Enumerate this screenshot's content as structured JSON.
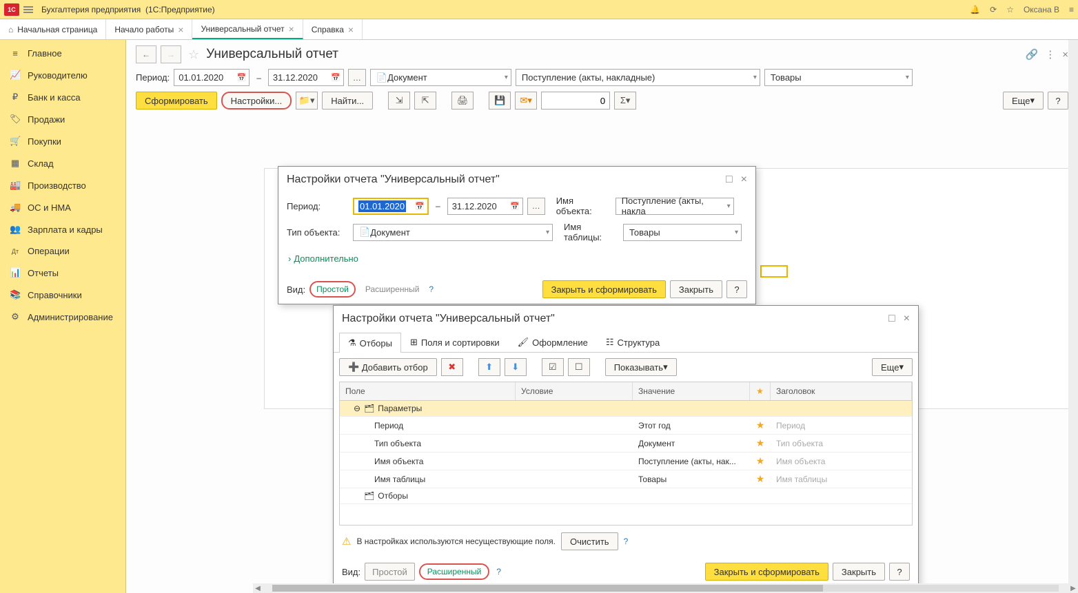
{
  "titlebar": {
    "app": "Бухгалтерия предприятия",
    "platform": "(1С:Предприятие)",
    "user": "Оксана В"
  },
  "main_tabs": [
    {
      "label": "Начальная страница",
      "closable": false,
      "home": true
    },
    {
      "label": "Начало работы",
      "closable": true
    },
    {
      "label": "Универсальный отчет",
      "closable": true,
      "active": true
    },
    {
      "label": "Справка",
      "closable": true
    }
  ],
  "sidebar": [
    {
      "icon": "≡",
      "label": "Главное"
    },
    {
      "icon": "📈",
      "label": "Руководителю"
    },
    {
      "icon": "₽",
      "label": "Банк и касса"
    },
    {
      "icon": "🏷",
      "label": "Продажи"
    },
    {
      "icon": "🛒",
      "label": "Покупки"
    },
    {
      "icon": "▦",
      "label": "Склад"
    },
    {
      "icon": "🏭",
      "label": "Производство"
    },
    {
      "icon": "🚚",
      "label": "ОС и НМА"
    },
    {
      "icon": "👥",
      "label": "Зарплата и кадры"
    },
    {
      "icon": "Дт",
      "label": "Операции"
    },
    {
      "icon": "📊",
      "label": "Отчеты"
    },
    {
      "icon": "📚",
      "label": "Справочники"
    },
    {
      "icon": "⚙",
      "label": "Администрирование"
    }
  ],
  "page": {
    "title": "Универсальный отчет"
  },
  "filters": {
    "period_label": "Период:",
    "date_from": "01.01.2020",
    "date_to": "31.12.2020",
    "dash": "–",
    "object_type": "Документ",
    "object_name": "Поступление (акты, накладные)",
    "table_name": "Товары"
  },
  "toolbar": {
    "form": "Сформировать",
    "settings": "Настройки...",
    "find": "Найти...",
    "num": "0",
    "more": "Еще",
    "help": "?"
  },
  "dialog1": {
    "title": "Настройки отчета \"Универсальный отчет\"",
    "period_label": "Период:",
    "date_from": "01.01.2020",
    "date_to": "31.12.2020",
    "objtype_label": "Тип объекта:",
    "objtype": "Документ",
    "objname_label": "Имя объекта:",
    "objname": "Поступление (акты, накла",
    "tblname_label": "Имя таблицы:",
    "tblname": "Товары",
    "more": "Дополнительно",
    "view_label": "Вид:",
    "view_simple": "Простой",
    "view_ext": "Расширенный",
    "close_form": "Закрыть и сформировать",
    "close": "Закрыть",
    "help": "?"
  },
  "dialog2": {
    "title": "Настройки отчета \"Универсальный отчет\"",
    "tabs": [
      {
        "icon": "⚗",
        "label": "Отборы",
        "active": true
      },
      {
        "icon": "⊞",
        "label": "Поля и сортировки"
      },
      {
        "icon": "🖌",
        "label": "Оформление"
      },
      {
        "icon": "☷",
        "label": "Структура"
      }
    ],
    "add_filter": "Добавить отбор",
    "show": "Показывать",
    "more": "Еще",
    "headers": {
      "field": "Поле",
      "cond": "Условие",
      "value": "Значение",
      "star": "★",
      "title": "Заголовок"
    },
    "rows": [
      {
        "tree": true,
        "field": "Параметры",
        "hl": true
      },
      {
        "field": "Период",
        "value": "Этот год",
        "star": true,
        "title": "Период"
      },
      {
        "field": "Тип объекта",
        "value": "Документ",
        "star": true,
        "title": "Тип объекта"
      },
      {
        "field": "Имя объекта",
        "value": "Поступление (акты, нак...",
        "star": true,
        "title": "Имя объекта"
      },
      {
        "field": "Имя таблицы",
        "value": "Товары",
        "star": true,
        "title": "Имя таблицы"
      },
      {
        "tree": true,
        "field": "Отборы"
      }
    ],
    "warning": "В настройках используются несуществующие поля.",
    "clear": "Очистить",
    "view_label": "Вид:",
    "view_simple": "Простой",
    "view_ext": "Расширенный",
    "close_form": "Закрыть и сформировать",
    "close": "Закрыть",
    "help": "?"
  }
}
